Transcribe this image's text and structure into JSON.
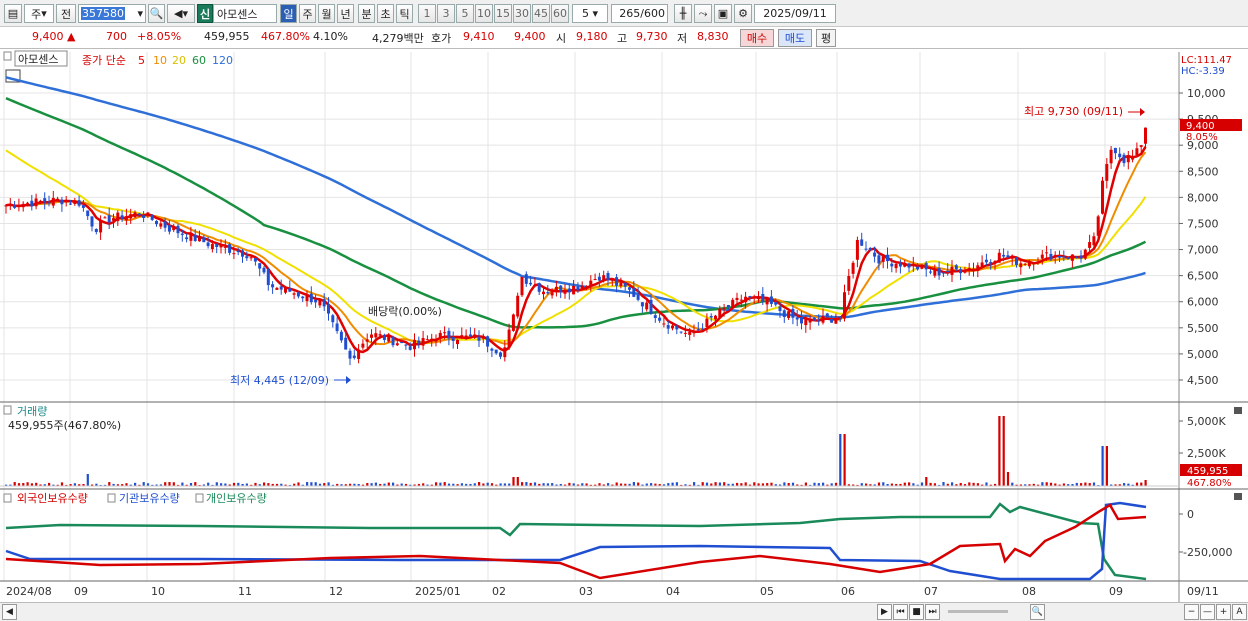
{
  "toolbar": {
    "market_type": "주",
    "prev_label": "전",
    "stock_code": "357580",
    "company_tag": "신",
    "company_name": "아모센스",
    "periods": [
      "일",
      "주",
      "월",
      "년",
      "분",
      "초",
      "틱"
    ],
    "active_period": "일",
    "intervals": [
      "1",
      "3",
      "5",
      "10",
      "15",
      "30",
      "45",
      "60"
    ],
    "custom_interval": "5",
    "data_count": "265",
    "data_total": "/600",
    "date": "2025/09/11"
  },
  "quote": {
    "price": "9,400",
    "change": "700",
    "change_pct": "+8.05%",
    "volume": "459,955",
    "volume_ratio": "467.80%",
    "turnover": "4.10%",
    "amount": "4,279백만",
    "bid_label": "호가",
    "bid": "9,410",
    "ask": "9,400",
    "open_label": "시",
    "open": "9,180",
    "high_label": "고",
    "high": "9,730",
    "low_label": "저",
    "low": "8,830",
    "buy_label": "매수",
    "sell_label": "매도",
    "avg_label": "평"
  },
  "price_panel": {
    "name_box": "아모센스",
    "ma_label": "종가 단순",
    "ma_periods": [
      {
        "p": "5",
        "color": "#e00000"
      },
      {
        "p": "10",
        "color": "#f08c00"
      },
      {
        "p": "20",
        "color": "#e0c800"
      },
      {
        "p": "60",
        "color": "#189040"
      },
      {
        "p": "120",
        "color": "#2f6fd8"
      }
    ],
    "lc": "LC:111.47",
    "hc": "HC:-3.39",
    "y_ticks": [
      "10,000",
      "9,500",
      "9,000",
      "8,500",
      "8,000",
      "7,500",
      "7,000",
      "6,500",
      "6,000",
      "5,500",
      "5,000",
      "4,500"
    ],
    "price_badge": "9,400",
    "pct_badge": "8.05%",
    "high_note": "최고 9,730 (09/11)",
    "low_note": "최저 4,445 (12/09)",
    "dividend_note": "배당락(0.00%)"
  },
  "volume_panel": {
    "title": "거래량",
    "value": "459,955주(467.80%)",
    "y_ticks": [
      "5,000K",
      "2,500K"
    ],
    "badge_value": "459,955",
    "badge_pct": "467.80%"
  },
  "holding_panel": {
    "series": [
      {
        "name": "외국인보유수량",
        "color": "#d60000"
      },
      {
        "name": "기관보유수량",
        "color": "#1f4fd0"
      },
      {
        "name": "개인보유수량",
        "color": "#1a8a5a"
      }
    ],
    "y_ticks": [
      "0",
      "-250,000"
    ]
  },
  "x_axis": [
    "2024/08",
    "09",
    "10",
    "11",
    "12",
    "2025/01",
    "02",
    "03",
    "04",
    "05",
    "06",
    "07",
    "08",
    "09",
    "09/11"
  ]
}
